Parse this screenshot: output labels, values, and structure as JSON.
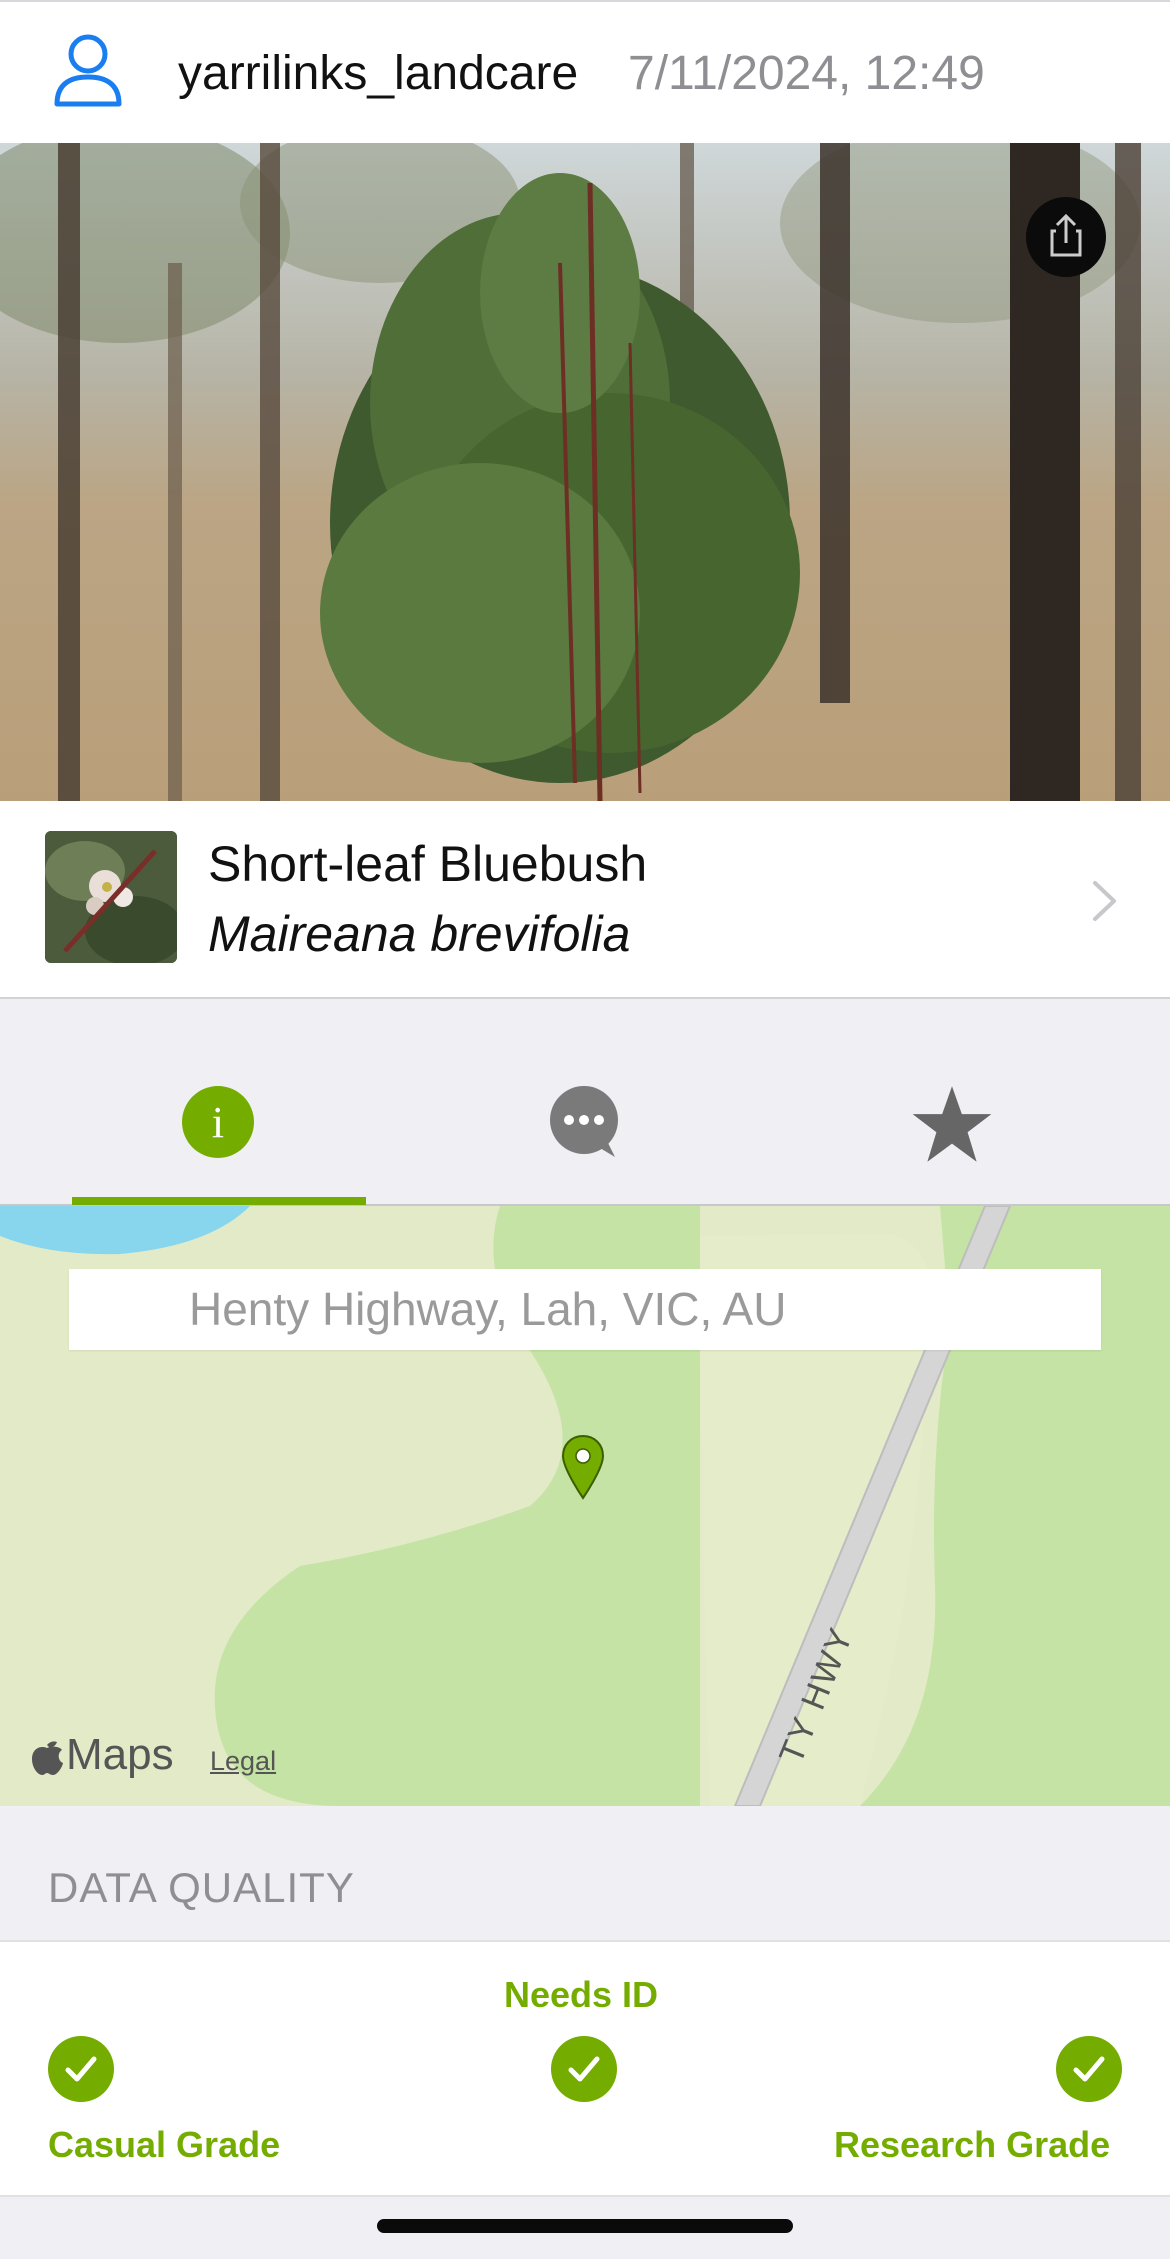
{
  "header": {
    "username": "yarrilinks_landcare",
    "timestamp": "7/11/2024, 12:49"
  },
  "taxon": {
    "common_name": "Short-leaf Bluebush",
    "scientific_name": "Maireana brevifolia"
  },
  "tabs": [
    {
      "name": "info",
      "icon": "info-icon",
      "active": true
    },
    {
      "name": "activity",
      "icon": "speech-bubble-icon",
      "active": false
    },
    {
      "name": "favorites",
      "icon": "star-icon",
      "active": false
    }
  ],
  "map": {
    "address": "Henty Highway, Lah, VIC, AU",
    "road_label": "TY HWY",
    "logo": "Maps",
    "legal": "Legal"
  },
  "data_quality": {
    "title": "DATA QUALITY",
    "needs_id": "Needs ID",
    "casual": "Casual Grade",
    "research": "Research Grade"
  },
  "colors": {
    "accent": "#74ac00",
    "link_blue": "#1a7ef0",
    "secondary_text": "#8e8e93"
  }
}
